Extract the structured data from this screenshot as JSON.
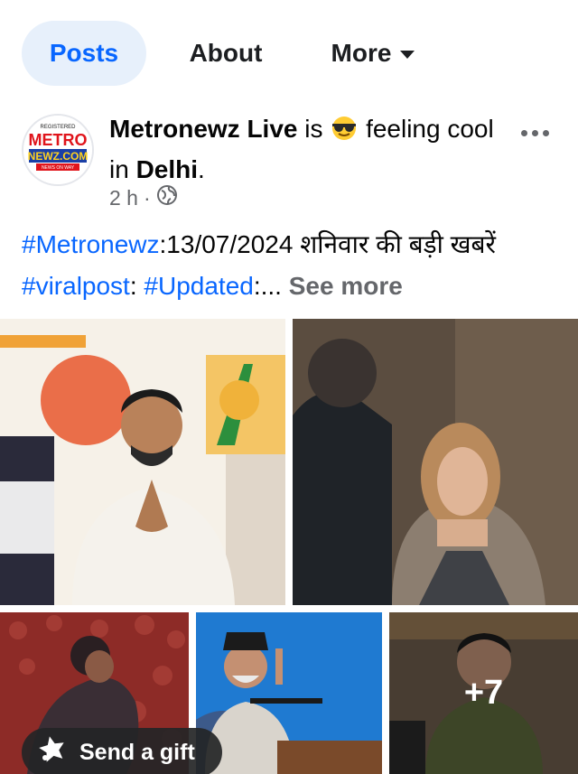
{
  "tabs": [
    {
      "label": "Posts",
      "active": true
    },
    {
      "label": "About",
      "active": false
    },
    {
      "label": "More",
      "active": false
    }
  ],
  "post": {
    "avatar_logo": {
      "line1": "METRO",
      "line2": "NEWZ.COM",
      "line3": "NEWS ON WAY",
      "top_text": "REGISTERED"
    },
    "author": "Metronewz Live",
    "is_text": "is",
    "feeling_text": "feeling cool in",
    "location": "Delhi",
    "period": ".",
    "time": "2 h",
    "separator": "·",
    "privacy_icon": "globe-icon",
    "more_icon": "more-horizontal-icon",
    "text": {
      "tag1": "#Metronewz",
      "part1": ":13/07/2024 शनिवार की  बड़ी खबरें  ",
      "tag2": "#viralpost",
      "part2": ": ",
      "tag3": "#Updated",
      "part3": ":... ",
      "see_more": "See more"
    },
    "photos": [
      {
        "alt": "photo-1"
      },
      {
        "alt": "photo-2"
      },
      {
        "alt": "photo-3"
      },
      {
        "alt": "photo-4"
      },
      {
        "alt": "photo-5",
        "overlay": "+7"
      }
    ]
  },
  "gift_button": {
    "label": "Send a gift",
    "icon": "gift-icon"
  },
  "colors": {
    "accent": "#0866ff",
    "tab_active_bg": "#e7f0fb",
    "secondary_text": "#65676b"
  }
}
